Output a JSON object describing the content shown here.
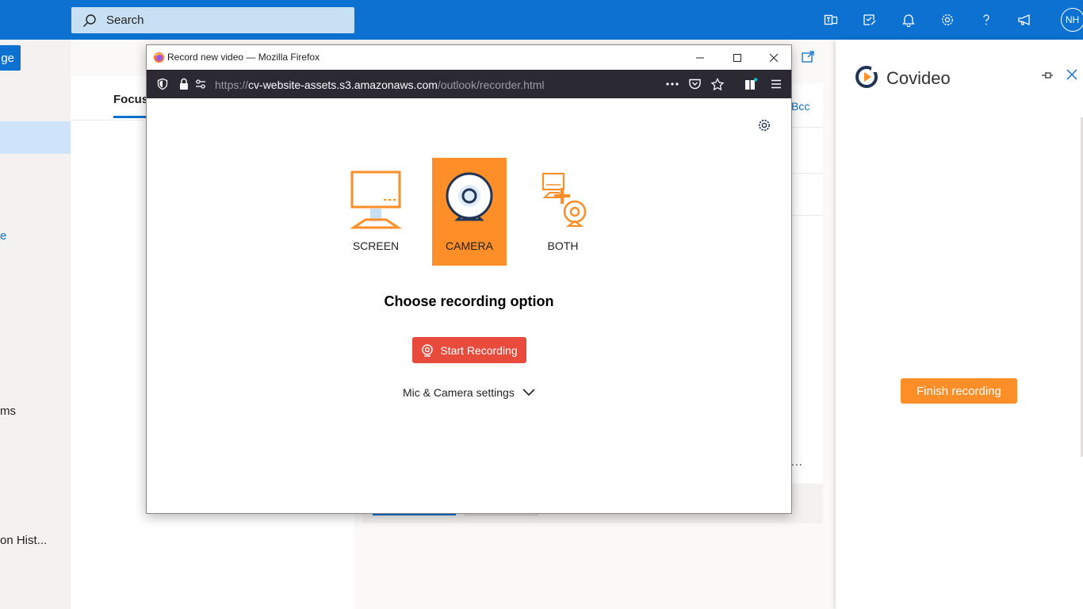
{
  "outlook": {
    "search_placeholder": "Search",
    "avatar_initials": "NH",
    "new_message_fragment": "ge",
    "nav_fragments": [
      "e",
      "ms",
      "on Hist..."
    ],
    "focused_tab": "Focuse",
    "bcc_label": "Bcc",
    "more_label": "..."
  },
  "covideo": {
    "title": "Covideo",
    "finish_label": "Finish recording",
    "accent": "#fd8e28"
  },
  "firefox": {
    "window_title": "Record new video — Mozilla Firefox",
    "url_prefix": "https://",
    "url_host": "cv-website-assets.s3.amazonaws.com",
    "url_path": "/outlook/recorder.html"
  },
  "recorder": {
    "options": [
      {
        "label": "SCREEN",
        "icon": "screen-icon",
        "selected": false
      },
      {
        "label": "CAMERA",
        "icon": "camera-icon",
        "selected": true
      },
      {
        "label": "BOTH",
        "icon": "both-icon",
        "selected": false
      }
    ],
    "heading": "Choose recording option",
    "start_label": "Start Recording",
    "start_color": "#e84a3c",
    "settings_label": "Mic & Camera settings"
  }
}
